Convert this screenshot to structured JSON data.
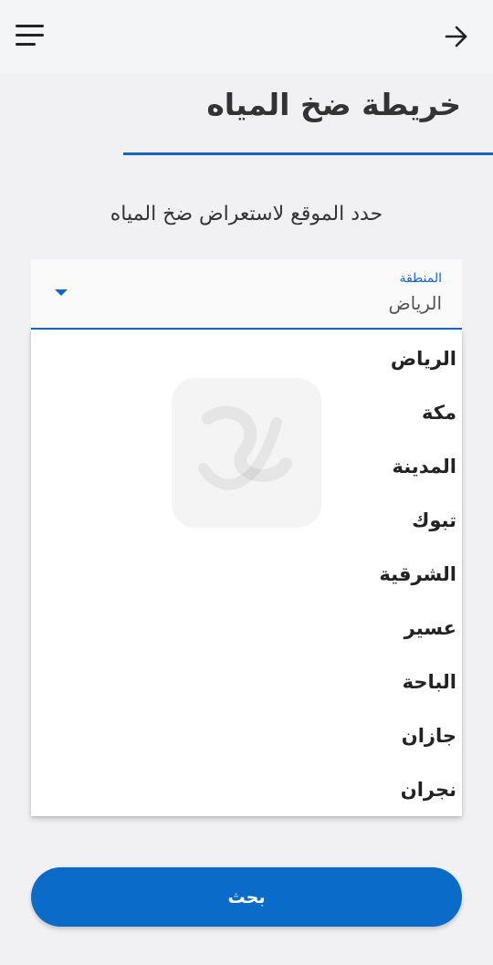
{
  "header": {
    "menu_icon": "hamburger-menu-icon",
    "back_icon": "arrow-right-icon"
  },
  "page": {
    "title": "خريطة ضخ المياه",
    "subtitle": "حدد الموقع لاستعراض ضخ المياه"
  },
  "region_select": {
    "label": "المنطقة",
    "value": "الرياض",
    "options": [
      "الرياض",
      "مكة",
      "المدينة",
      "تبوك",
      "الشرقية",
      "عسير",
      "الباحة",
      "جازان",
      "نجران"
    ]
  },
  "search_button": {
    "label": "بحث"
  },
  "colors": {
    "accent": "#1565c0",
    "button": "#0a6bc9",
    "background": "#f1f1f3"
  }
}
